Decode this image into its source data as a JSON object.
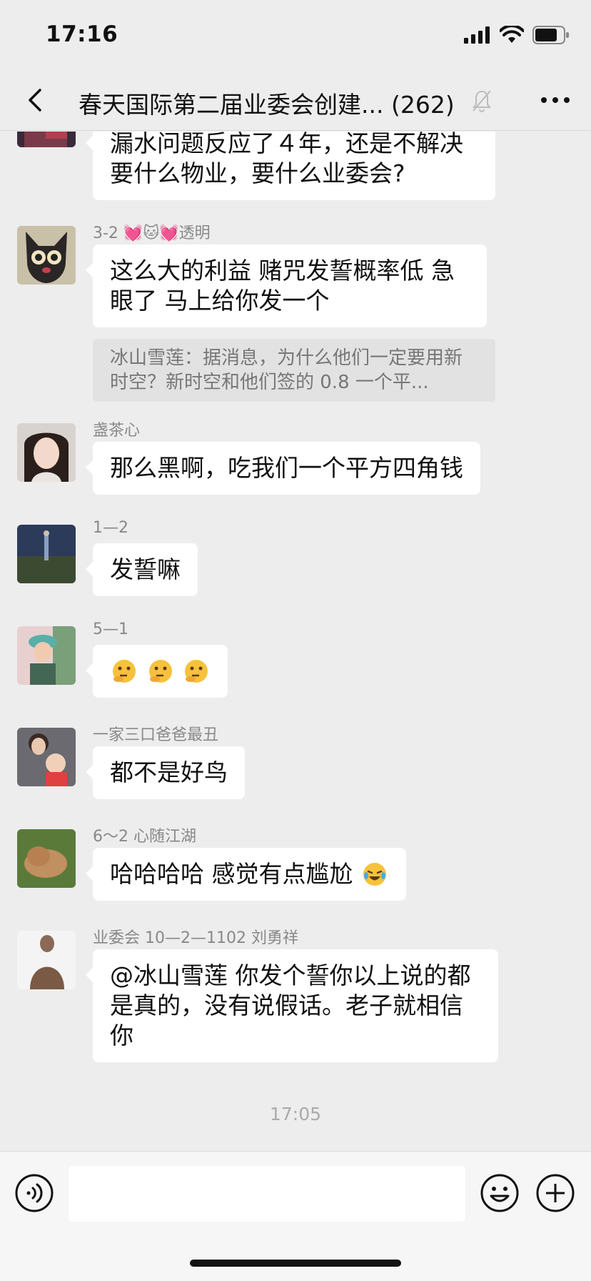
{
  "status": {
    "time": "17:16"
  },
  "nav": {
    "title": "春天国际第二届业委会创建... (262)"
  },
  "messages": [
    {
      "sender": "",
      "text": "漏水问题反应了４年，还是不解决要什么物业，要什么业委会?"
    },
    {
      "sender": "3-2 💓🐱💓透明",
      "text": "这么大的利益 赌咒发誓概率低 急眼了 马上给你发一个",
      "quote": "冰山雪莲：据消息，为什么他们一定要用新时空？新时空和他们签的 0.8 一个平..."
    },
    {
      "sender": "盏茶心",
      "text": "那么黑啊，吃我们一个平方四角钱"
    },
    {
      "sender": "1—2",
      "text": "发誓嘛"
    },
    {
      "sender": "5—1",
      "text": ""
    },
    {
      "sender": "一家三口爸爸最丑",
      "text": "都不是好鸟"
    },
    {
      "sender": "6～2 心随江湖",
      "text": "哈哈哈哈 感觉有点尴尬"
    },
    {
      "sender": "业委会 10—2—1102 刘勇祥",
      "text": "@冰山雪莲 你发个誓你以上说的都是真的，没有说假话。老子就相信你"
    }
  ],
  "time_separator": "17:05",
  "input": {
    "placeholder": ""
  },
  "colors": {
    "background": "#ededed",
    "bubble": "#ffffff",
    "quote": "#e2e2e2"
  },
  "icons": [
    "back-icon",
    "mute-bell-icon",
    "more-icon",
    "voice-icon",
    "emoji-icon",
    "plus-icon",
    "thinking-face-emoji",
    "laughing-tears-emoji"
  ]
}
